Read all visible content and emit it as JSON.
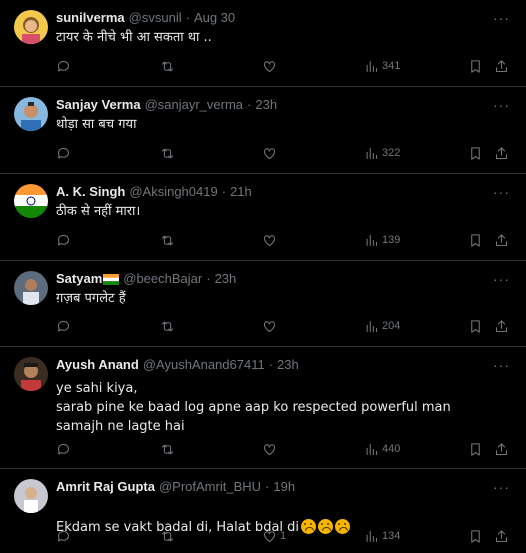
{
  "tweets": [
    {
      "name": "sunilverma",
      "handle": "@svsunil",
      "dot": "·",
      "time": "Aug 30",
      "text": "टायर के नीचे भी आ सकता था ..",
      "replies": "",
      "retweets": "",
      "likes": "",
      "views": "341",
      "avatar_color": "#f2c94c"
    },
    {
      "name": "Sanjay Verma",
      "handle": "@sanjayr_verma",
      "dot": "·",
      "time": "23h",
      "text": "थोड़ा सा बच गया",
      "replies": "",
      "retweets": "",
      "likes": "",
      "views": "322",
      "avatar_color": "#87b8e0"
    },
    {
      "name": "A. K. Singh",
      "handle": "@Aksingh0419",
      "dot": "·",
      "time": "21h",
      "text": "ठीक से नहीं मारा।",
      "replies": "",
      "retweets": "",
      "likes": "",
      "views": "139",
      "avatar_color": "#ff9933"
    },
    {
      "name": "Satyam",
      "handle": "@beechBajar",
      "dot": "·",
      "time": "23h",
      "text": "ग़ज़ब पगलेट हैं",
      "replies": "",
      "retweets": "",
      "likes": "",
      "views": "204",
      "avatar_color": "#6b7d95"
    },
    {
      "name": "Ayush Anand",
      "handle": "@AyushAnand67411",
      "dot": "·",
      "time": "23h",
      "text": "ye sahi kiya,\nsarab pine ke baad log apne aap ko respected powerful man samajh ne lagte hai",
      "replies": "",
      "retweets": "",
      "likes": "",
      "views": "440",
      "avatar_color": "#7a5a3a"
    },
    {
      "name": "Amrit Raj Gupta",
      "handle": "@ProfAmrit_BHU",
      "dot": "·",
      "time": "19h",
      "text": "Ekdam se vakt badal di, Halat bdal di",
      "replies": "",
      "retweets": "",
      "likes": "1",
      "views": "134",
      "avatar_color": "#c8c8d0"
    }
  ],
  "more_label": "···",
  "colors": {
    "muted": "#71767b",
    "text": "#e7e9ea",
    "divider": "#2f3336"
  }
}
